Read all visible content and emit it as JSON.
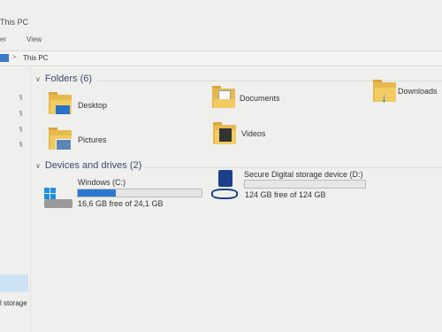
{
  "window": {
    "title": "This PC"
  },
  "ribbon": {
    "tab_left": "er",
    "tab_view": "View"
  },
  "address": {
    "location": "This PC",
    "separator": ">"
  },
  "nav": {
    "partial_label": "l storage"
  },
  "folders": {
    "header": "Folders (6)",
    "items": [
      {
        "label": "Desktop",
        "icon": "desktop-folder-icon"
      },
      {
        "label": "Documents",
        "icon": "documents-folder-icon"
      },
      {
        "label": "Downloads",
        "icon": "downloads-folder-icon"
      },
      {
        "label": "Pictures",
        "icon": "pictures-folder-icon"
      },
      {
        "label": "Videos",
        "icon": "videos-folder-icon"
      }
    ]
  },
  "drives": {
    "header": "Devices and drives (2)",
    "items": [
      {
        "label": "Windows (C:)",
        "free_text": "16,6 GB free of 24,1 GB",
        "used_fraction": 0.31,
        "icon": "windows-drive-icon"
      },
      {
        "label": "Secure Digital storage device (D:)",
        "free_text": "124 GB free of 124 GB",
        "used_fraction": 0.0,
        "icon": "sd-card-drive-icon"
      }
    ]
  }
}
